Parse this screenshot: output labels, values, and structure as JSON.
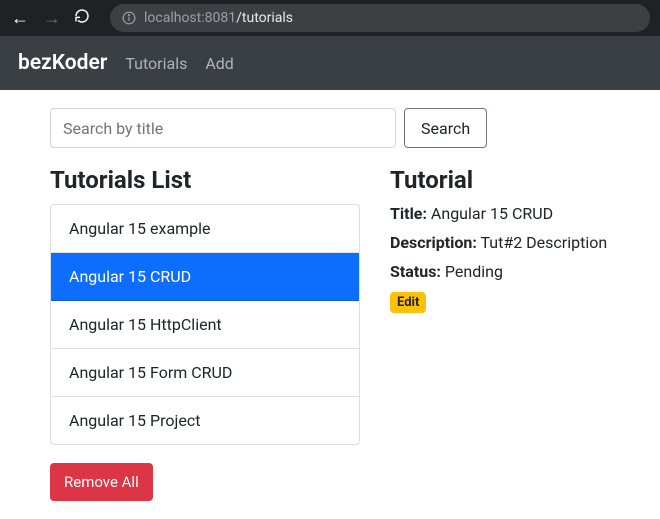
{
  "browser": {
    "url_host": "localhost",
    "url_port": ":8081",
    "url_path": "/tutorials"
  },
  "navbar": {
    "brand": "bezKoder",
    "links": [
      "Tutorials",
      "Add"
    ]
  },
  "search": {
    "placeholder": "Search by title",
    "button": "Search"
  },
  "list": {
    "heading": "Tutorials List",
    "items": [
      "Angular 15 example",
      "Angular 15 CRUD",
      "Angular 15 HttpClient",
      "Angular 15 Form CRUD",
      "Angular 15 Project"
    ],
    "active_index": 1,
    "remove_all": "Remove All"
  },
  "detail": {
    "heading": "Tutorial",
    "labels": {
      "title": "Title:",
      "description": "Description:",
      "status": "Status:"
    },
    "title": "Angular 15 CRUD",
    "description": "Tut#2 Description",
    "status": "Pending",
    "edit": "Edit"
  }
}
